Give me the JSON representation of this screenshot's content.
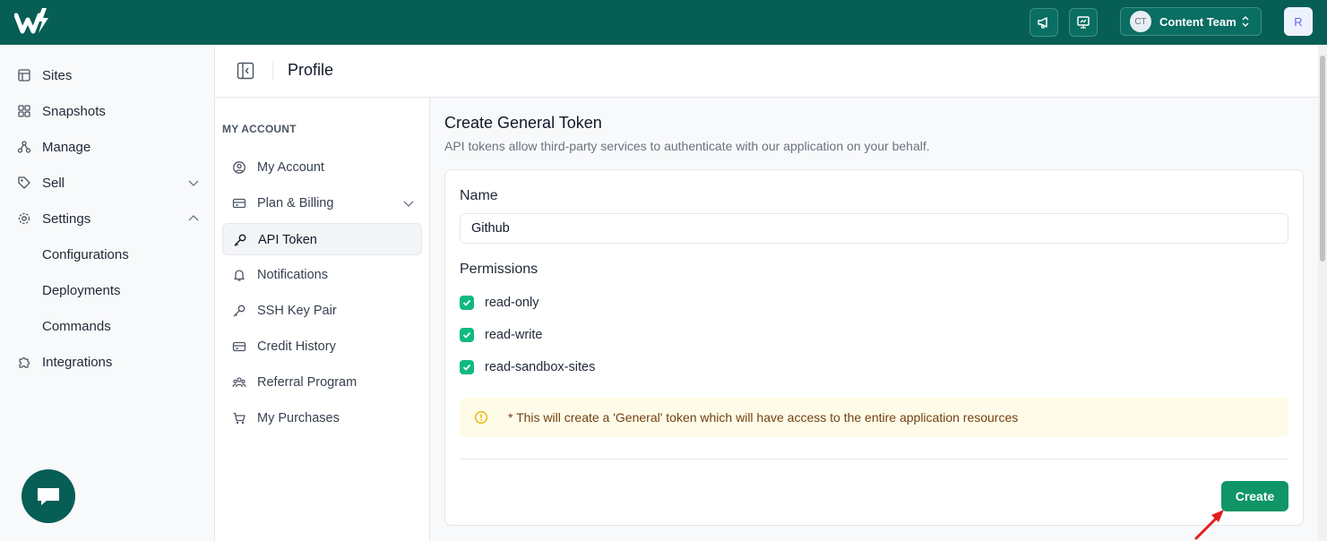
{
  "topbar": {
    "announce_icon": "megaphone-icon",
    "present_icon": "presentation-icon",
    "team_initials": "CT",
    "team_name": "Content Team",
    "user_initial": "R",
    "brand_color": "#075e54"
  },
  "sidebar": {
    "items": [
      {
        "label": "Sites",
        "icon": "layout-icon"
      },
      {
        "label": "Snapshots",
        "icon": "grid-icon"
      },
      {
        "label": "Manage",
        "icon": "nodes-icon"
      },
      {
        "label": "Sell",
        "icon": "tag-icon"
      },
      {
        "label": "Settings",
        "icon": "gear-icon"
      },
      {
        "label": "Configurations"
      },
      {
        "label": "Deployments"
      },
      {
        "label": "Commands"
      },
      {
        "label": "Integrations",
        "icon": "puzzle-icon"
      }
    ]
  },
  "header": {
    "title": "Profile"
  },
  "account_menu": {
    "section_label": "MY ACCOUNT",
    "items": [
      {
        "label": "My Account",
        "icon": "user-circle-icon"
      },
      {
        "label": "Plan & Billing",
        "icon": "card-icon"
      },
      {
        "label": "API Token",
        "icon": "key-icon",
        "active": true
      },
      {
        "label": "Notifications",
        "icon": "bell-icon"
      },
      {
        "label": "SSH Key Pair",
        "icon": "key-icon"
      },
      {
        "label": "Credit History",
        "icon": "card-icon"
      },
      {
        "label": "Referral Program",
        "icon": "users-icon"
      },
      {
        "label": "My Purchases",
        "icon": "cart-icon"
      }
    ]
  },
  "main": {
    "title": "Create General Token",
    "description": "API tokens allow third-party services to authenticate with our application on your behalf.",
    "name_label": "Name",
    "name_value": "Github",
    "permissions_label": "Permissions",
    "permissions": [
      {
        "label": "read-only",
        "checked": true
      },
      {
        "label": "read-write",
        "checked": true
      },
      {
        "label": "read-sandbox-sites",
        "checked": true
      }
    ],
    "notice": "* This will create a 'General' token which will have access to the entire application resources",
    "create_label": "Create",
    "accent_color": "#0f9566"
  }
}
